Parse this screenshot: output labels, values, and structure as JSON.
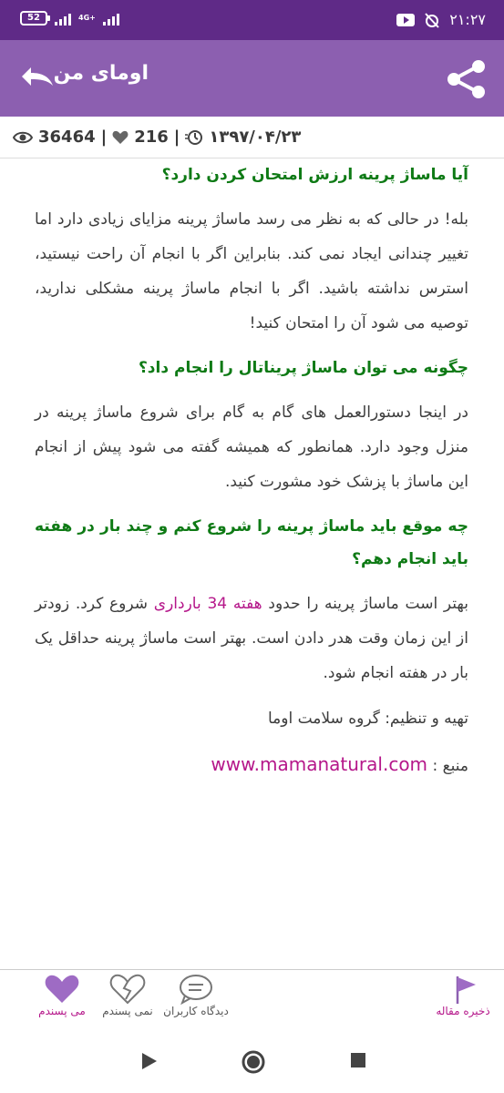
{
  "status_bar": {
    "battery": "52",
    "network": "4G+",
    "time": "۲۱:۲۷"
  },
  "app_bar": {
    "title": "اومای من"
  },
  "meta": {
    "views": "36464",
    "likes": "216",
    "date": "۱۳۹۷/۰۴/۲۳",
    "separator": "|"
  },
  "article": {
    "blocks": [
      {
        "type": "heading",
        "text": "آیا ماساژ پرینه ارزش امتحان کردن دارد؟"
      },
      {
        "type": "paragraph",
        "text": "بله! در حالی که به نظر می رسد ماساژ پرینه مزایای زیادی دارد اما تغییر چندانی ایجاد نمی کند. بنابراین اگر با انجام آن راحت نیستید، استرس نداشته باشید. اگر با انجام ماساژ پرینه مشکلی ندارید، توصیه می شود آن را امتحان کنید!"
      },
      {
        "type": "heading",
        "text": "چگونه می توان ماساژ پریناتال را انجام داد؟"
      },
      {
        "type": "paragraph",
        "text": "در اینجا دستورالعمل های گام به گام برای شروع ماساژ پرینه در منزل وجود دارد. همانطور که همیشه گفته می شود پیش از انجام این ماساژ با پزشک خود مشورت کنید."
      },
      {
        "type": "heading",
        "text": "چه موقع باید ماساژ پرینه را شروع کنم و چند بار در هفته باید انجام دهم؟"
      }
    ],
    "timing_para": {
      "before": "بهتر است ماساژ پرینه را حدود ",
      "highlight": "هفته 34 بارداری",
      "after": " شروع کرد. زودتر از این زمان وقت هدر دادن است. بهتر است ماساژ پرینه حداقل یک بار در هفته انجام شود."
    },
    "credit": "تهیه و تنظیم: گروه سلامت اوما",
    "source_label": "منبع : ",
    "source_link": "www.mamanatural.com"
  },
  "actions": {
    "like": "می پسندم",
    "dislike": "نمی پسندم",
    "comments": "دیدگاه کاربران",
    "save": "ذخیره مقاله"
  },
  "colors": {
    "status_bar": "#5f2a87",
    "app_bar": "#8c5fb0",
    "heading": "#0e7a15",
    "accent": "#b5178a"
  }
}
